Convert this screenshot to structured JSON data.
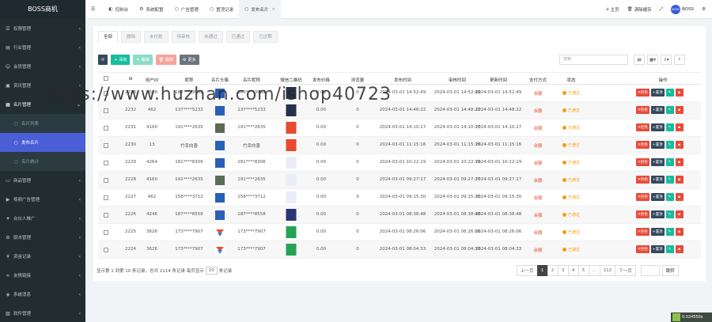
{
  "brand": "BOSS商机",
  "sidebar": [
    {
      "label": "权限管理",
      "icon": "users-icon",
      "type": "top"
    },
    {
      "label": "行业管理",
      "icon": "list-icon",
      "type": "top"
    },
    {
      "label": "会员管理",
      "icon": "user-icon",
      "type": "top"
    },
    {
      "label": "资讯管理",
      "icon": "news-icon",
      "type": "top"
    },
    {
      "label": "名片管理",
      "icon": "card-icon",
      "type": "open"
    },
    {
      "label": "名片列表",
      "icon": "circle-icon",
      "type": "sub"
    },
    {
      "label": "发布名片",
      "icon": "circle-icon",
      "type": "active"
    },
    {
      "label": "名片统计",
      "icon": "circle-icon",
      "type": "sub"
    },
    {
      "label": "商品管理",
      "icon": "box-icon",
      "type": "top"
    },
    {
      "label": "视频广告管理",
      "icon": "video-icon",
      "type": "top"
    },
    {
      "label": "合伙人推广",
      "icon": "share-icon",
      "type": "top"
    },
    {
      "label": "版本管理",
      "icon": "gear-icon",
      "type": "top"
    },
    {
      "label": "资金记录",
      "icon": "money-icon",
      "type": "top"
    },
    {
      "label": "友情链接",
      "icon": "link-icon",
      "type": "top"
    },
    {
      "label": "系统消息",
      "icon": "bell-icon",
      "type": "top"
    },
    {
      "label": "软件管理",
      "icon": "app-icon",
      "type": "top"
    }
  ],
  "tabs": [
    {
      "label": "控制台",
      "icon": "dashboard-icon",
      "active": false,
      "close": false
    },
    {
      "label": "系统配置",
      "icon": "gear-icon",
      "active": false,
      "close": false
    },
    {
      "label": "广告管理",
      "icon": "circle-icon",
      "active": false,
      "close": false
    },
    {
      "label": "置顶记录",
      "icon": "circle-icon",
      "active": false,
      "close": false
    },
    {
      "label": "发布名片",
      "icon": "circle-icon",
      "active": true,
      "close": true
    }
  ],
  "topright": {
    "home": "主页",
    "clear_cache": "清除缓存",
    "user": "BOSS",
    "avatar": "BOSS"
  },
  "filter_tabs": [
    "全部",
    "删除",
    "未付款",
    "待审核",
    "未通过",
    "已通过",
    "已过期"
  ],
  "toolbar": {
    "refresh": "⟳",
    "add": "添加",
    "edit": "编辑",
    "delete": "删除",
    "more": "更多"
  },
  "search": {
    "placeholder": "搜索"
  },
  "columns": [
    "Id",
    "用户ID",
    "昵称",
    "名片头像",
    "名片昵称",
    "微信二维码",
    "发布价格",
    "浏览量",
    "发布时间",
    "审核时间",
    "更新时间",
    "支付方式",
    "状态",
    "操作"
  ],
  "rows": [
    {
      "id": "2233",
      "uid": "3526",
      "nick": "182****3052",
      "name": "182****3052",
      "price": "0.00",
      "views": "0",
      "pub": "2024-03-01 14:52:49",
      "audit": "2024-03-01 14:52:49",
      "upd": "2024-03-01 14:52:49",
      "pay": "余额",
      "status": "已通过",
      "av": "blue",
      "qr": "dark"
    },
    {
      "id": "2232",
      "uid": "462",
      "nick": "137****5233",
      "name": "137****5233",
      "price": "0.00",
      "views": "0",
      "pub": "2024-03-01 14:48:22",
      "audit": "2024-03-01 14:48:22",
      "upd": "2024-03-01 14:48:22",
      "pay": "余额",
      "status": "已通过",
      "av": "blue",
      "qr": "dark"
    },
    {
      "id": "2231",
      "uid": "4160",
      "nick": "191****2635",
      "name": "191****2635",
      "price": "0.00",
      "views": "0",
      "pub": "2024-03-01 14:10:17",
      "audit": "2024-03-01 14:10:17",
      "upd": "2024-03-01 14:10:17",
      "pay": "余额",
      "status": "已通过",
      "av": "photo",
      "qr": "red"
    },
    {
      "id": "2230",
      "uid": "13",
      "nick": "竹幸向善",
      "name": "竹幸向善",
      "price": "0.00",
      "views": "0",
      "pub": "2024-03-01 11:15:16",
      "audit": "2024-03-01 11:15:16",
      "upd": "2024-03-01 11:15:16",
      "pay": "余额",
      "status": "已通过",
      "av": "blue",
      "qr": "red"
    },
    {
      "id": "2229",
      "uid": "4264",
      "nick": "181****8306",
      "name": "181****8306",
      "price": "0.00",
      "views": "0",
      "pub": "2024-03-01 10:22:19",
      "audit": "2024-03-01 10:22:19",
      "upd": "2024-03-01 10:22:19",
      "pay": "余额",
      "status": "已通过",
      "av": "blue",
      "qr": "light"
    },
    {
      "id": "2228",
      "uid": "4160",
      "nick": "191****2635",
      "name": "191****2635",
      "price": "0.00",
      "views": "0",
      "pub": "2024-03-01 09:27:17",
      "audit": "2024-03-01 09:27:17",
      "upd": "2024-03-01 09:27:17",
      "pay": "余额",
      "status": "已通过",
      "av": "photo",
      "qr": "light"
    },
    {
      "id": "2227",
      "uid": "462",
      "nick": "158****3712",
      "name": "158****3712",
      "price": "0.00",
      "views": "0",
      "pub": "2024-03-01 09:15:30",
      "audit": "2024-03-01 09:15:30",
      "upd": "2024-03-01 09:15:30",
      "pay": "余额",
      "status": "已通过",
      "av": "blue",
      "qr": "light"
    },
    {
      "id": "2226",
      "uid": "4246",
      "nick": "187****8558",
      "name": "187****8558",
      "price": "0.00",
      "views": "0",
      "pub": "2024-03-01 08:38:48",
      "audit": "2024-03-01 08:38:48",
      "upd": "2024-03-01 08:38:48",
      "pay": "余额",
      "status": "已通过",
      "av": "blue",
      "qr": "navy"
    },
    {
      "id": "2225",
      "uid": "3626",
      "nick": "173****7907",
      "name": "173****7907",
      "price": "0.00",
      "views": "0",
      "pub": "2024-03-01 08:26:06",
      "audit": "2024-03-01 08:26:06",
      "upd": "2024-03-01 08:26:06",
      "pay": "余额",
      "status": "已通过",
      "av": "logo",
      "qr": "green"
    },
    {
      "id": "2224",
      "uid": "3626",
      "nick": "173****7907",
      "name": "173****7907",
      "price": "0.00",
      "views": "0",
      "pub": "2024-03-01 08:04:33",
      "audit": "2024-03-01 08:04:33",
      "upd": "2024-03-01 08:04:33",
      "pay": "余额",
      "status": "已通过",
      "av": "logo",
      "qr": "green"
    }
  ],
  "ops": {
    "reject": "拒绝",
    "top": "置顶"
  },
  "footer": {
    "summary_a": "显示第 1 到第 10 条记录，总共 2114 条记录 每页显示",
    "page_size": "10",
    "summary_b": "条记录"
  },
  "pager": {
    "prev": "上一页",
    "pages": [
      "1",
      "2",
      "3",
      "4",
      "5",
      "...",
      "212"
    ],
    "next": "下一页",
    "go": "跳转"
  },
  "watermark": "https://www.huzhan.com/ishop40723",
  "timer": "0.024550s"
}
